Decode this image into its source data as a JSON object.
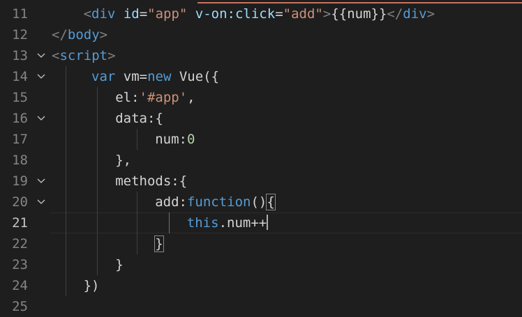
{
  "editor": {
    "lines": [
      {
        "number": "11",
        "fold": false,
        "tokens": [
          {
            "t": "<",
            "c": "punct"
          },
          {
            "t": "div",
            "c": "tag"
          },
          {
            "t": " id",
            "c": "attr"
          },
          {
            "t": "=",
            "c": "text"
          },
          {
            "t": "\"app\"",
            "c": "str"
          },
          {
            "t": " v-on:click",
            "c": "attr"
          },
          {
            "t": "=",
            "c": "text"
          },
          {
            "t": "\"add\"",
            "c": "str"
          },
          {
            "t": ">",
            "c": "punct"
          },
          {
            "t": "{{num}}",
            "c": "text"
          },
          {
            "t": "</",
            "c": "punct"
          },
          {
            "t": "div",
            "c": "tag"
          },
          {
            "t": ">",
            "c": "punct"
          }
        ]
      },
      {
        "number": "12",
        "fold": false,
        "tokens": [
          {
            "t": "</",
            "c": "punct"
          },
          {
            "t": "body",
            "c": "tag"
          },
          {
            "t": ">",
            "c": "punct"
          }
        ]
      },
      {
        "number": "13",
        "fold": true,
        "tokens": [
          {
            "t": "<",
            "c": "punct"
          },
          {
            "t": "script",
            "c": "tag"
          },
          {
            "t": ">",
            "c": "punct"
          }
        ]
      },
      {
        "number": "14",
        "fold": true,
        "tokens": [
          {
            "t": "var",
            "c": "kw"
          },
          {
            "t": " vm=",
            "c": "text"
          },
          {
            "t": "new",
            "c": "kw"
          },
          {
            "t": " Vue({",
            "c": "text"
          }
        ]
      },
      {
        "number": "15",
        "fold": false,
        "tokens": [
          {
            "t": "el:",
            "c": "text"
          },
          {
            "t": "'#app'",
            "c": "str"
          },
          {
            "t": ",",
            "c": "text"
          }
        ]
      },
      {
        "number": "16",
        "fold": true,
        "tokens": [
          {
            "t": "data:{",
            "c": "text"
          }
        ]
      },
      {
        "number": "17",
        "fold": false,
        "tokens": [
          {
            "t": "num:",
            "c": "text"
          },
          {
            "t": "0",
            "c": "num"
          }
        ]
      },
      {
        "number": "18",
        "fold": false,
        "tokens": [
          {
            "t": "},",
            "c": "text"
          }
        ]
      },
      {
        "number": "19",
        "fold": true,
        "tokens": [
          {
            "t": "methods:{",
            "c": "text"
          }
        ]
      },
      {
        "number": "20",
        "fold": true,
        "tokens": [
          {
            "t": "add:",
            "c": "text"
          },
          {
            "t": "function",
            "c": "kw"
          },
          {
            "t": "()",
            "c": "text"
          },
          {
            "t": "{",
            "c": "text",
            "box": true
          }
        ]
      },
      {
        "number": "21",
        "fold": false,
        "current": true,
        "tokens": [
          {
            "t": "this",
            "c": "kw"
          },
          {
            "t": ".num++",
            "c": "text"
          }
        ]
      },
      {
        "number": "22",
        "fold": false,
        "tokens": [
          {
            "t": "}",
            "c": "text",
            "box": true
          }
        ]
      },
      {
        "number": "23",
        "fold": false,
        "tokens": [
          {
            "t": "}",
            "c": "text"
          }
        ]
      },
      {
        "number": "24",
        "fold": false,
        "tokens": [
          {
            "t": "})",
            "c": "text"
          }
        ]
      },
      {
        "number": "25",
        "fold": false,
        "tokens": []
      }
    ],
    "colors": {
      "background": "#1e1e1e",
      "line_number": "#858585",
      "current_line_number": "#c6c6c6",
      "tag": "#569cd6",
      "attribute": "#9cdcfe",
      "string": "#ce9178",
      "keyword": "#569cd6",
      "number": "#b5cea8",
      "text": "#d4d4d4",
      "error_squiggle": "#f48771"
    },
    "fold_icon": "chevron-down-icon"
  }
}
